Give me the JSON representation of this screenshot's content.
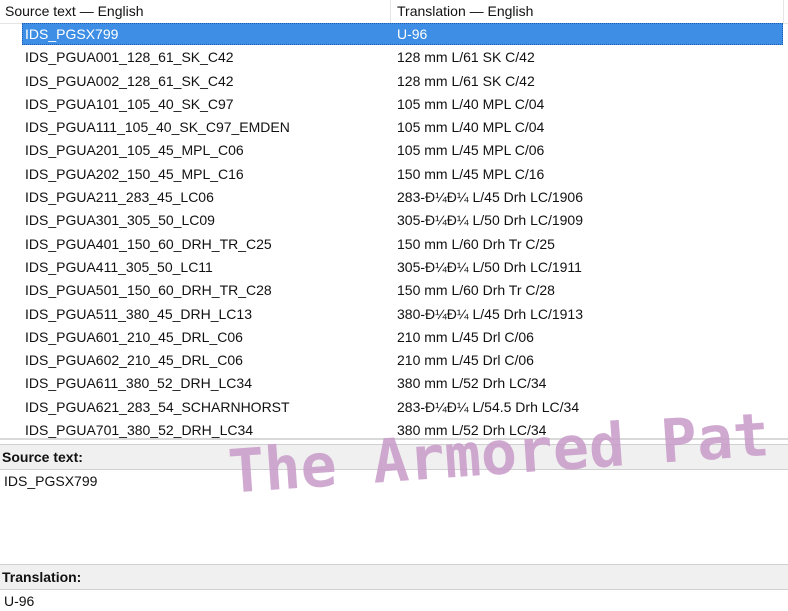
{
  "table": {
    "headers": {
      "source": "Source text — English",
      "translation": "Translation — English"
    },
    "selected_index": 0,
    "rows": [
      {
        "source": "IDS_PGSX799",
        "translation": "U-96"
      },
      {
        "source": "IDS_PGUA001_128_61_SK_C42",
        "translation": "128 mm L/61 SK C/42"
      },
      {
        "source": "IDS_PGUA002_128_61_SK_C42",
        "translation": "128 mm L/61 SK C/42"
      },
      {
        "source": "IDS_PGUA101_105_40_SK_C97",
        "translation": "105 mm L/40 MPL C/04"
      },
      {
        "source": "IDS_PGUA111_105_40_SK_C97_EMDEN",
        "translation": "105 mm L/40 MPL C/04"
      },
      {
        "source": "IDS_PGUA201_105_45_MPL_C06",
        "translation": "105 mm L/45 MPL C/06"
      },
      {
        "source": "IDS_PGUA202_150_45_MPL_C16",
        "translation": "150 mm L/45 MPL C/16"
      },
      {
        "source": "IDS_PGUA211_283_45_LC06",
        "translation": "283-Đ¼Đ¼ L/45 Drh LC/1906"
      },
      {
        "source": "IDS_PGUA301_305_50_LC09",
        "translation": "305-Đ¼Đ¼ L/50 Drh LC/1909"
      },
      {
        "source": "IDS_PGUA401_150_60_DRH_TR_C25",
        "translation": "150 mm L/60 Drh Tr C/25"
      },
      {
        "source": "IDS_PGUA411_305_50_LC11",
        "translation": "305-Đ¼Đ¼ L/50 Drh LC/1911"
      },
      {
        "source": "IDS_PGUA501_150_60_DRH_TR_C28",
        "translation": "150 mm L/60 Drh Tr C/28"
      },
      {
        "source": "IDS_PGUA511_380_45_DRH_LC13",
        "translation": "380-Đ¼Đ¼ L/45 Drh LC/1913"
      },
      {
        "source": "IDS_PGUA601_210_45_DRL_C06",
        "translation": "210 mm L/45 Drl C/06"
      },
      {
        "source": "IDS_PGUA602_210_45_DRL_C06",
        "translation": "210 mm L/45 Drl C/06"
      },
      {
        "source": "IDS_PGUA611_380_52_DRH_LC34",
        "translation": "380 mm L/52 Drh LC/34"
      },
      {
        "source": "IDS_PGUA621_283_54_SCHARNHORST",
        "translation": "283-Đ¼Đ¼ L/54.5 Drh LC/34"
      },
      {
        "source": "IDS_PGUA701_380_52_DRH_LC34",
        "translation": "380 mm L/52 Drh LC/34"
      }
    ]
  },
  "source_panel": {
    "label": "Source text:",
    "text": "IDS_PGSX799"
  },
  "translation_panel": {
    "label": "Translation:",
    "text": "U-96"
  },
  "watermark": {
    "text": "The Armored Patrol",
    "color": "#c89ac9"
  },
  "colors": {
    "selection": "#3d8ee4",
    "panel_bg": "#f0f0f0"
  }
}
